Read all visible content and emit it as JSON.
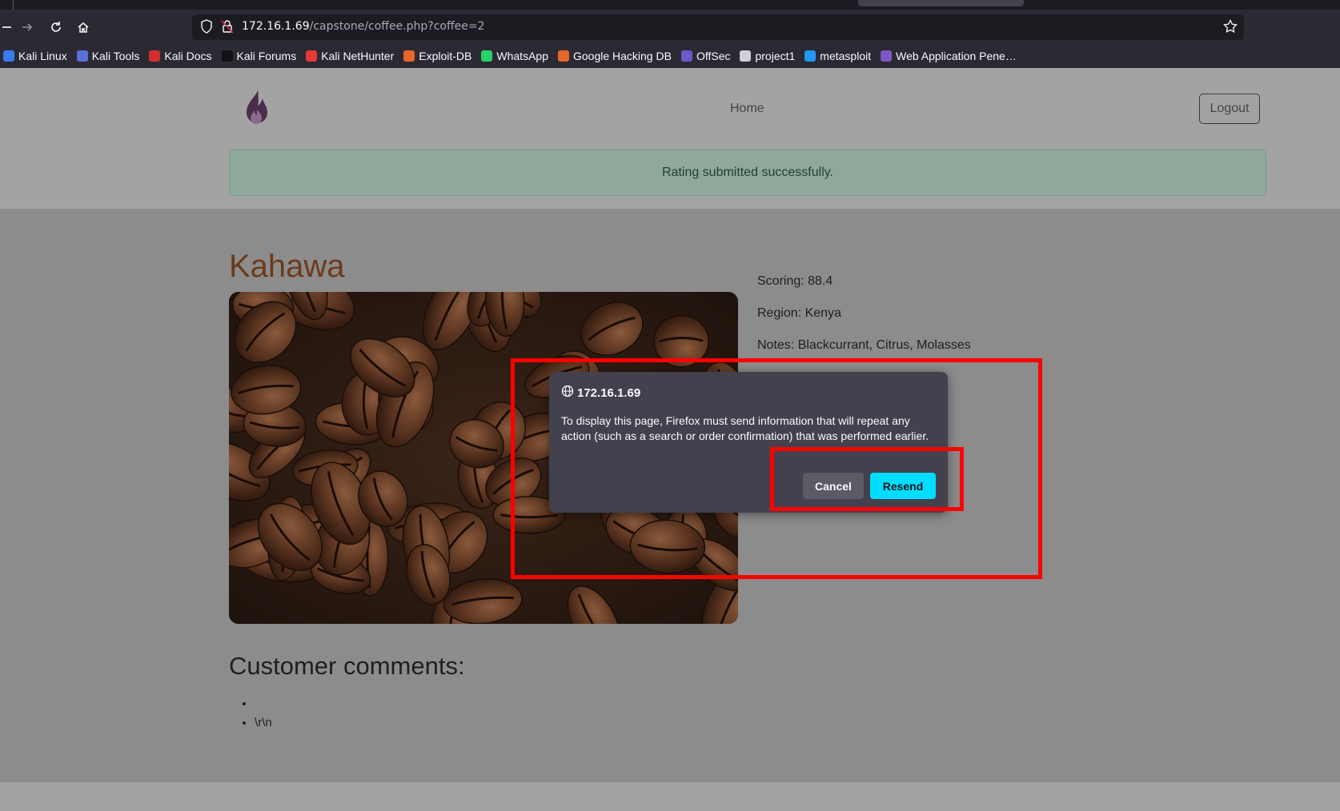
{
  "browser": {
    "url_host": "172.16.1.69",
    "url_path": "/capstone/coffee.php?coffee=2",
    "bookmarks": [
      {
        "label": "Kali Linux",
        "color": "#367bf0"
      },
      {
        "label": "Kali Tools",
        "color": "#5a6fd8"
      },
      {
        "label": "Kali Docs",
        "color": "#d32f2f"
      },
      {
        "label": "Kali Forums",
        "color": "#111111"
      },
      {
        "label": "Kali NetHunter",
        "color": "#e53935"
      },
      {
        "label": "Exploit-DB",
        "color": "#e8662a"
      },
      {
        "label": "WhatsApp",
        "color": "#25d366"
      },
      {
        "label": "Google Hacking DB",
        "color": "#e8662a"
      },
      {
        "label": "OffSec",
        "color": "#6a5acd"
      },
      {
        "label": "project1",
        "color": "#cfcfd8"
      },
      {
        "label": "metasploit",
        "color": "#2196f3"
      },
      {
        "label": "Web Application Pene…",
        "color": "#7e57c2"
      }
    ]
  },
  "site": {
    "nav_home": "Home",
    "logout": "Logout",
    "alert": "Rating submitted successfully."
  },
  "coffee": {
    "name": "Kahawa",
    "scoring": "Scoring: 88.4",
    "region": "Region: Kenya",
    "notes": "Notes: Blackcurrant, Citrus, Molasses",
    "comments_title": "Customer comments:",
    "comments": [
      "",
      "\\r\\n"
    ]
  },
  "dialog": {
    "host": "172.16.1.69",
    "message": "To display this page, Firefox must send information that will repeat any action (such as a search or order confirmation) that was performed earlier.",
    "cancel": "Cancel",
    "resend": "Resend"
  },
  "colors": {
    "accent_resend": "#00ddff",
    "annotation": "#ff0000",
    "title_brown": "#6d3a1a"
  }
}
